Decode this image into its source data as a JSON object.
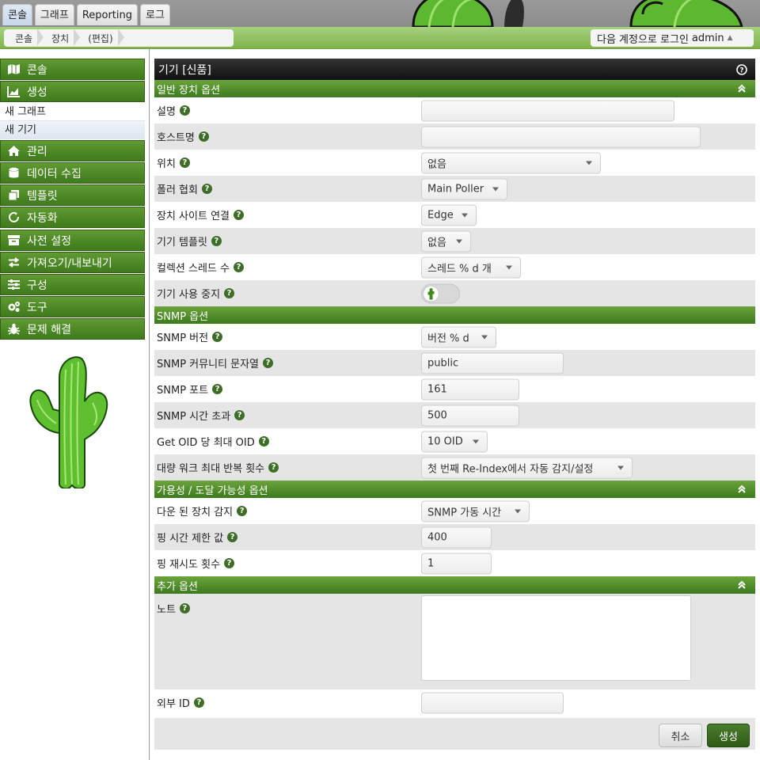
{
  "top_tabs": [
    "콘솔",
    "그래프",
    "Reporting",
    "로그"
  ],
  "breadcrumb": [
    "콘솔",
    "장치",
    "(편집)"
  ],
  "login": {
    "text": "다음 계정으로 로그인",
    "user": "admin"
  },
  "sidebar": {
    "items": [
      {
        "label": "콘솔",
        "icon": "map-icon"
      },
      {
        "label": "생성",
        "icon": "chart-icon"
      },
      {
        "label": "관리",
        "icon": "home-icon"
      },
      {
        "label": "데이터 수집",
        "icon": "database-icon"
      },
      {
        "label": "템플릿",
        "icon": "copy-icon"
      },
      {
        "label": "자동화",
        "icon": "sync-icon"
      },
      {
        "label": "사전 설정",
        "icon": "archive-icon"
      },
      {
        "label": "가져오기/내보내기",
        "icon": "exchange-icon"
      },
      {
        "label": "구성",
        "icon": "sliders-icon"
      },
      {
        "label": "도구",
        "icon": "gears-icon"
      },
      {
        "label": "문제 해결",
        "icon": "bug-icon"
      }
    ],
    "subitems": [
      "새 그래프",
      "새 기기"
    ]
  },
  "page_title": "기기 [신품]",
  "sections": {
    "general": "일반 장치 옵션",
    "snmp": "SNMP 옵션",
    "availability": "가용성 / 도달 가능성 옵션",
    "additional": "추가 옵션"
  },
  "general_fields": {
    "description": {
      "label": "설명",
      "value": ""
    },
    "hostname": {
      "label": "호스트명",
      "value": ""
    },
    "location": {
      "label": "위치",
      "value": "없음"
    },
    "poller": {
      "label": "폴러 협회",
      "value": "Main Poller"
    },
    "site": {
      "label": "장치 사이트 연결",
      "value": "Edge"
    },
    "template": {
      "label": "기기 템플릿",
      "value": "없음"
    },
    "threads": {
      "label": "컬렉션 스레드 수",
      "value": "스레드 % d 개"
    },
    "disable": {
      "label": "기기 사용 중지",
      "checked": false
    }
  },
  "snmp_fields": {
    "version": {
      "label": "SNMP 버전",
      "value": "버전 % d"
    },
    "community": {
      "label": "SNMP 커뮤니티 문자열",
      "value": "public"
    },
    "port": {
      "label": "SNMP 포트",
      "value": "161"
    },
    "timeout": {
      "label": "SNMP 시간 초과",
      "value": "500"
    },
    "max_oids": {
      "label": "Get OID 당 최대 OID",
      "value": "10 OID"
    },
    "bulk_walk": {
      "label": "대량 워크 최대 반복 횟수",
      "value": "첫 번째 Re-Index에서 자동 감지/설정"
    }
  },
  "availability_fields": {
    "down_detect": {
      "label": "다운 된 장치 감지",
      "value": "SNMP 가동 시간"
    },
    "ping_timeout": {
      "label": "핑 시간 제한 값",
      "value": "400"
    },
    "ping_retries": {
      "label": "핑 재시도 횟수",
      "value": "1"
    }
  },
  "additional_fields": {
    "notes": {
      "label": "노트",
      "value": ""
    },
    "external_id": {
      "label": "외부 ID",
      "value": ""
    }
  },
  "buttons": {
    "cancel": "취소",
    "create": "생성"
  },
  "colors": {
    "nav_green": "#4a8526",
    "header_dark": "#222222",
    "row_alt": "#e5e5e5"
  }
}
